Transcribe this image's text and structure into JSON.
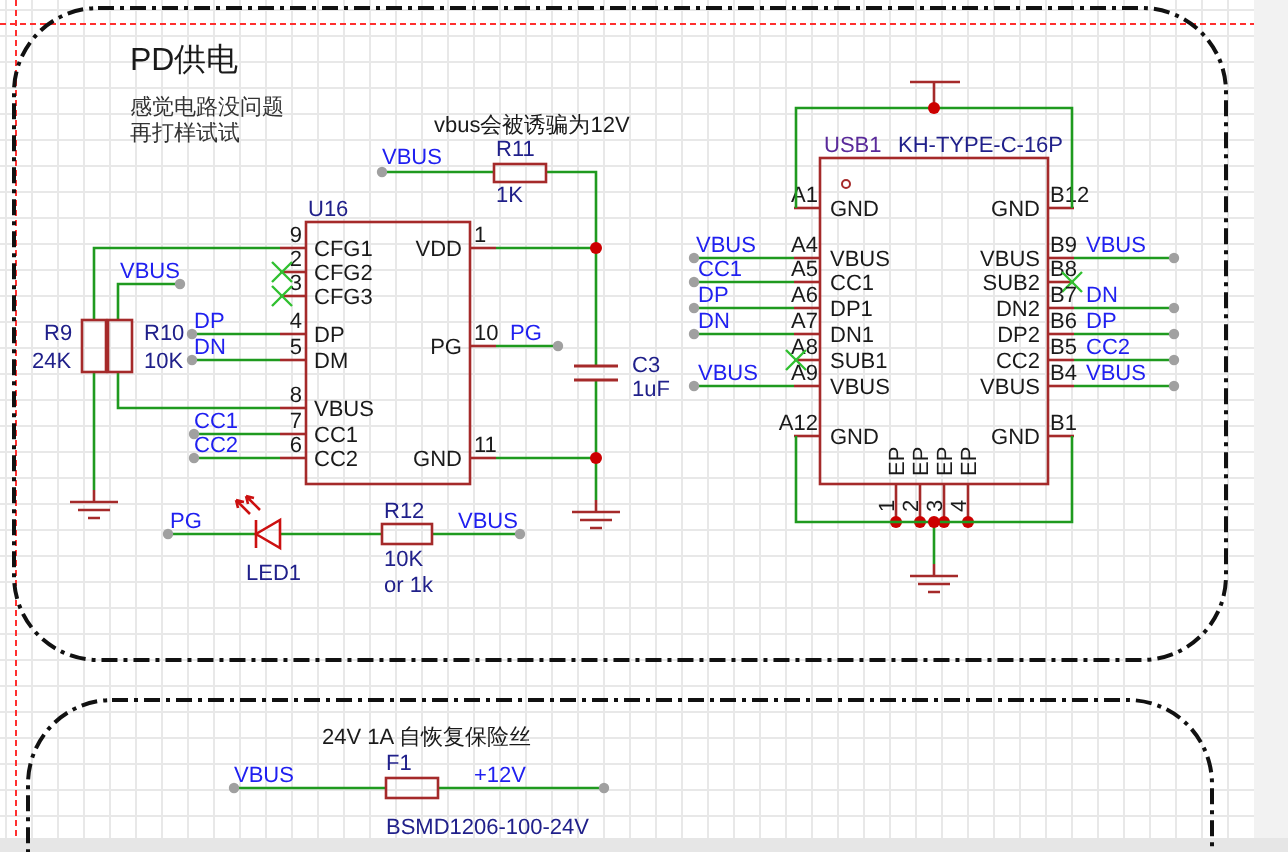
{
  "sheet": {
    "title": "PD供电",
    "note_lines": [
      "感觉电路没问题",
      "再打样试试"
    ],
    "annotation": "vbus会被诱骗为12V"
  },
  "u16": {
    "designator": "U16",
    "left_pins": [
      {
        "number": "9",
        "name": "CFG1",
        "no_connect": false
      },
      {
        "number": "2",
        "name": "CFG2",
        "no_connect": true
      },
      {
        "number": "3",
        "name": "CFG3",
        "no_connect": true
      },
      {
        "number": "4",
        "name": "DP",
        "no_connect": false
      },
      {
        "number": "5",
        "name": "DM",
        "no_connect": false
      },
      {
        "number": "8",
        "name": "VBUS",
        "no_connect": false
      },
      {
        "number": "7",
        "name": "CC1",
        "no_connect": false
      },
      {
        "number": "6",
        "name": "CC2",
        "no_connect": false
      }
    ],
    "right_pins": [
      {
        "number": "1",
        "name": "VDD",
        "no_connect": false
      },
      {
        "number": "10",
        "name": "PG",
        "no_connect": false
      },
      {
        "number": "11",
        "name": "GND",
        "no_connect": false
      }
    ]
  },
  "usb1": {
    "designator": "USB1",
    "part": "KH-TYPE-C-16P",
    "left_pins": [
      {
        "number": "A1",
        "name": "GND",
        "no_connect": false
      },
      {
        "number": "A4",
        "name": "VBUS",
        "no_connect": false
      },
      {
        "number": "A5",
        "name": "CC1",
        "no_connect": false
      },
      {
        "number": "A6",
        "name": "DP1",
        "no_connect": false
      },
      {
        "number": "A7",
        "name": "DN1",
        "no_connect": false
      },
      {
        "number": "A8",
        "name": "SUB1",
        "no_connect": true
      },
      {
        "number": "A9",
        "name": "VBUS",
        "no_connect": false
      },
      {
        "number": "A12",
        "name": "GND",
        "no_connect": false
      }
    ],
    "right_pins": [
      {
        "number": "B12",
        "name": "GND",
        "no_connect": false
      },
      {
        "number": "B9",
        "name": "VBUS",
        "no_connect": false
      },
      {
        "number": "B8",
        "name": "SUB2",
        "no_connect": true
      },
      {
        "number": "B7",
        "name": "DN2",
        "no_connect": false
      },
      {
        "number": "B6",
        "name": "DP2",
        "no_connect": false
      },
      {
        "number": "B5",
        "name": "CC2",
        "no_connect": false
      },
      {
        "number": "B4",
        "name": "VBUS",
        "no_connect": false
      },
      {
        "number": "B1",
        "name": "GND",
        "no_connect": false
      }
    ],
    "exposed_pads": [
      {
        "number": "1",
        "name": "EP"
      },
      {
        "number": "2",
        "name": "EP"
      },
      {
        "number": "3",
        "name": "EP"
      },
      {
        "number": "4",
        "name": "EP"
      }
    ]
  },
  "parts": [
    {
      "kind": "resistor",
      "designator": "R11",
      "values": [
        "1K"
      ]
    },
    {
      "kind": "resistor",
      "designator": "R9",
      "values": [
        "24K"
      ]
    },
    {
      "kind": "resistor",
      "designator": "R10",
      "values": [
        "10K"
      ]
    },
    {
      "kind": "capacitor",
      "designator": "C3",
      "values": [
        "1uF"
      ]
    },
    {
      "kind": "led",
      "designator": "LED1"
    },
    {
      "kind": "resistor",
      "designator": "R12",
      "values": [
        "10K",
        "or 1k"
      ]
    }
  ],
  "net_labels": [
    "VBUS",
    "VBUS",
    "DP",
    "DN",
    "CC1",
    "CC2",
    "PG",
    "PG",
    "VBUS",
    "VBUS",
    "CC1",
    "DP",
    "DN",
    "VBUS",
    "VBUS",
    "DN",
    "DP",
    "CC2",
    "VBUS"
  ],
  "fuse_section": {
    "note": "24V 1A 自恢复保险丝",
    "designator": "F1",
    "value": "BSMD1206-100-24V",
    "net_labels": [
      "VBUS",
      "+12V"
    ]
  }
}
